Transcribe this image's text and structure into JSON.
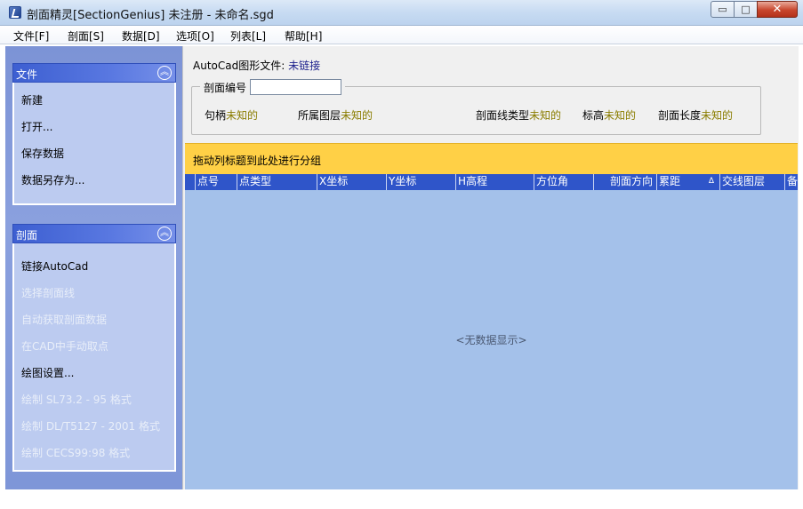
{
  "window": {
    "title": "剖面精灵[SectionGenius] 未注册 - 未命名.sgd",
    "minimize": "▭",
    "maximize": "□",
    "close": "✕"
  },
  "menu": [
    {
      "label": "文件[F]"
    },
    {
      "label": "剖面[S]"
    },
    {
      "label": "数据[D]"
    },
    {
      "label": "选项[O]"
    },
    {
      "label": "列表[L]"
    },
    {
      "label": "帮助[H]"
    }
  ],
  "sidebar": {
    "file_group": {
      "title": "文件",
      "items": [
        {
          "label": "新建",
          "enabled": true
        },
        {
          "label": "打开...",
          "enabled": true
        },
        {
          "label": "保存数据",
          "enabled": true
        },
        {
          "label": "数据另存为...",
          "enabled": true
        }
      ]
    },
    "section_group": {
      "title": "剖面",
      "items": [
        {
          "label": "链接AutoCad",
          "enabled": true
        },
        {
          "label": "选择剖面线",
          "enabled": false
        },
        {
          "label": "自动获取剖面数据",
          "enabled": false
        },
        {
          "label": "在CAD中手动取点",
          "enabled": false
        },
        {
          "label": "绘图设置...",
          "enabled": true
        },
        {
          "label": "绘制 SL73.2 - 95 格式",
          "enabled": false
        },
        {
          "label": "绘制 DL/T5127 - 2001 格式",
          "enabled": false
        },
        {
          "label": "绘制 CECS99:98 格式",
          "enabled": false
        }
      ]
    },
    "collapse_glyph": "︽"
  },
  "main": {
    "cad_label": "AutoCad图形文件:",
    "cad_status": "未链接",
    "section_no_label": "剖面编号",
    "section_no_value": "",
    "props": [
      {
        "label": "句柄",
        "value": "未知的"
      },
      {
        "label": "所属图层",
        "value": "未知的"
      },
      {
        "label": "剖面线类型",
        "value": "未知的"
      },
      {
        "label": "标高",
        "value": "未知的"
      },
      {
        "label": "剖面长度",
        "value": "未知的"
      }
    ],
    "group_hint": "拖动列标题到此处进行分组",
    "columns": [
      "点号",
      "点类型",
      "X坐标",
      "Y坐标",
      "H高程",
      "方位角",
      "剖面方向",
      "累距",
      "交线图层",
      "备"
    ],
    "sorted_column_icon": "Δ",
    "empty_text": "<无数据显示>"
  }
}
